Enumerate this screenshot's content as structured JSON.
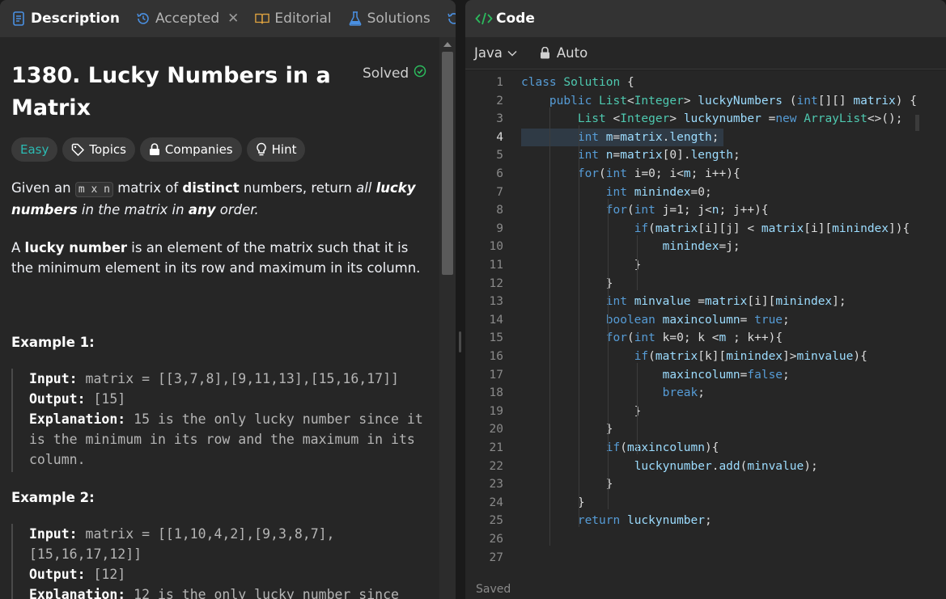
{
  "tabs": [
    {
      "label": "Description",
      "icon": "document-icon"
    },
    {
      "label": "Accepted",
      "icon": "history-icon"
    },
    {
      "label": "Editorial",
      "icon": "book-icon"
    },
    {
      "label": "Solutions",
      "icon": "flask-icon"
    }
  ],
  "problem": {
    "title": "1380. Lucky Numbers in a Matrix",
    "status": "Solved",
    "chips": [
      "Easy",
      "Topics",
      "Companies",
      "Hint"
    ],
    "desc1": {
      "a": "Given an ",
      "code": "m x n",
      "b": " matrix of ",
      "c": "distinct",
      "d": " numbers, return ",
      "e": "all ",
      "f": "lucky numbers",
      "g": " in the matrix in ",
      "h": "any",
      "i": " order."
    },
    "desc2": {
      "a": "A ",
      "b": "lucky number",
      "c": " is an element of the matrix such that it is the minimum element in its row and maximum in its column."
    },
    "examples": [
      {
        "title": "Example 1:",
        "input_label": "Input:",
        "input": " matrix = [[3,7,8],[9,11,13],[15,16,17]]",
        "output_label": "Output:",
        "output": " [15]",
        "explanation_label": "Explanation:",
        "explanation": " 15 is the only lucky number since it is the minimum in its row and the maximum in its column."
      },
      {
        "title": "Example 2:",
        "input_label": "Input:",
        "input": " matrix = [[1,10,4,2],[9,3,8,7],[15,16,17,12]]",
        "output_label": "Output:",
        "output": " [12]",
        "explanation_label": "Explanation:",
        "explanation": " 12 is the only lucky number since"
      }
    ]
  },
  "editor": {
    "header": "Code",
    "language": "Java",
    "mode": "Auto",
    "status": "Saved",
    "line_numbers": [
      "1",
      "2",
      "3",
      "4",
      "5",
      "6",
      "7",
      "8",
      "9",
      "10",
      "11",
      "12",
      "13",
      "14",
      "15",
      "16",
      "17",
      "18",
      "19",
      "20",
      "21",
      "22",
      "23",
      "24",
      "25",
      "26",
      "27"
    ],
    "lines": [
      "class Solution {",
      "    public List<Integer> luckyNumbers (int[][] matrix) {",
      "        List <Integer> luckynumber =new ArrayList<>();",
      "        int m=matrix.length;",
      "        int n=matrix[0].length;",
      "        for(int i=0; i<m; i++){",
      "            int minindex=0;",
      "            for(int j=1; j<n; j++){",
      "                if(matrix[i][j] < matrix[i][minindex]){",
      "                    minindex=j;",
      "                }",
      "            }",
      "            int minvalue =matrix[i][minindex];",
      "            boolean maxincolumn= true;",
      "            for(int k=0; k <m ; k++){",
      "                if(matrix[k][minindex]>minvalue){",
      "                    maxincolumn=false;",
      "                    break;",
      "                }",
      "            }",
      "            if(maxincolumn){",
      "                luckynumber.add(minvalue);",
      "            }",
      "        }",
      "        return luckynumber;",
      "",
      ""
    ]
  },
  "colors": {
    "easy": "#2cbbb3",
    "keyword": "#569cd6",
    "type": "#4ec9b0",
    "identifier": "#9cdcfe"
  }
}
